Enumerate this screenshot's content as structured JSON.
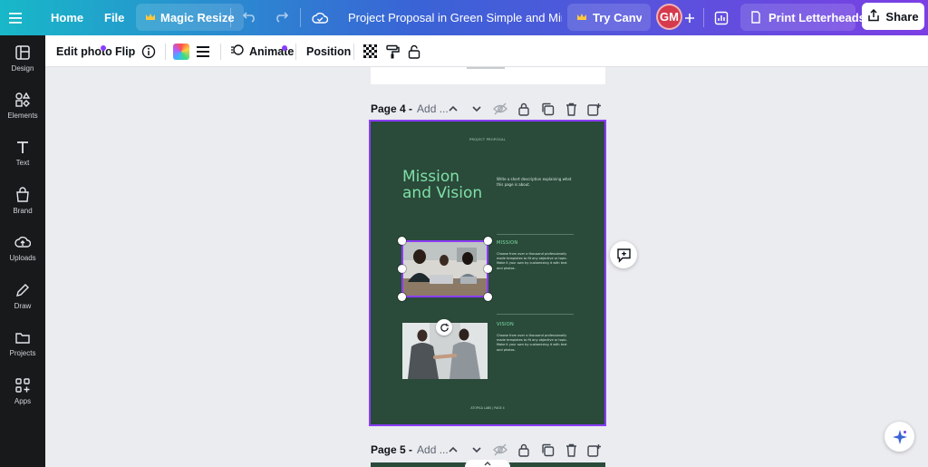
{
  "topbar": {
    "home": "Home",
    "file": "File",
    "magic_resize": "Magic Resize",
    "document_title": "Project Proposal in Green Simple and Mini...",
    "try_canva": "Try Canva",
    "avatar_initials": "GM",
    "print": "Print Letterheads",
    "share": "Share"
  },
  "sidebar": {
    "items": [
      {
        "label": "Design",
        "icon": "design-icon"
      },
      {
        "label": "Elements",
        "icon": "elements-icon"
      },
      {
        "label": "Text",
        "icon": "text-icon"
      },
      {
        "label": "Brand",
        "icon": "brand-icon"
      },
      {
        "label": "Uploads",
        "icon": "uploads-icon"
      },
      {
        "label": "Draw",
        "icon": "draw-icon"
      },
      {
        "label": "Projects",
        "icon": "projects-icon"
      },
      {
        "label": "Apps",
        "icon": "apps-icon"
      }
    ]
  },
  "toolbar": {
    "edit_photo": "Edit photo",
    "flip": "Flip",
    "animate": "Animate",
    "position": "Position"
  },
  "pages": {
    "page4_label": "Page 4 -",
    "page4_placeholder": "Add ...",
    "page5_label": "Page 5 -",
    "page5_placeholder": "Add ..."
  },
  "slide": {
    "eyebrow": "PROJECT PROPOSAL",
    "title_line1": "Mission",
    "title_line2": "and Vision",
    "description": "Write a short description explaining what this page is about.",
    "mission_heading": "MISSION",
    "mission_body": "Choose from over a thousand professionally made templates to fit any objective or topic. Make it your own by customizing it with text and photos.",
    "vision_heading": "VISION",
    "vision_body": "Choose from over a thousand professionally made templates to fit any objective or topic. Make it your own by customizing it with text and photos.",
    "footer": "ATOPICA LABS | PAGE 4"
  },
  "colors": {
    "brand_purple": "#8b3dff",
    "slide_green": "#2a4a3a",
    "accent_green": "#7fe0a8"
  }
}
